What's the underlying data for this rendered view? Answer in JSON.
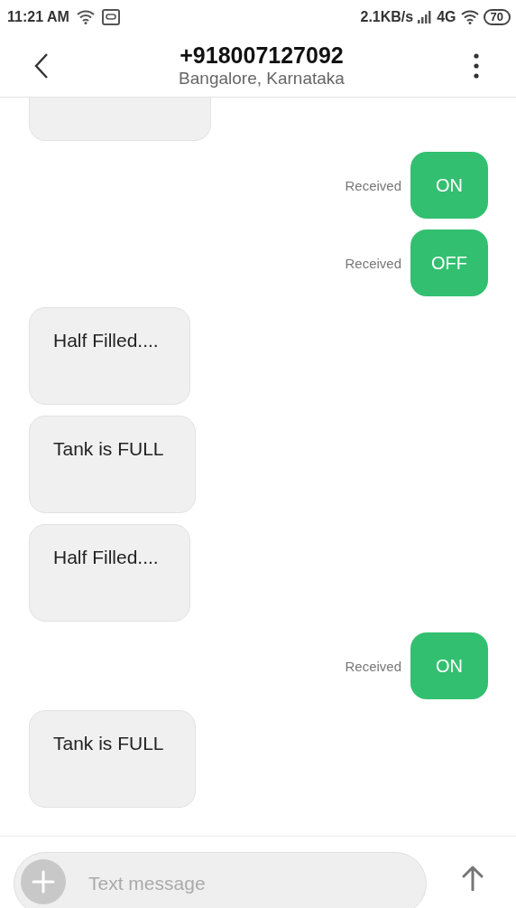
{
  "status_bar": {
    "time": "11:21 AM",
    "speed": "2.1KB/s",
    "network": "4G",
    "battery": "70"
  },
  "header": {
    "title": "+918007127092",
    "subtitle": "Bangalore, Karnataka"
  },
  "messages": [
    {
      "kind": "incoming",
      "cut": true
    },
    {
      "kind": "outgoing",
      "text": "ON",
      "status": "Received"
    },
    {
      "kind": "outgoing",
      "text": "OFF",
      "status": "Received"
    },
    {
      "kind": "incoming",
      "text": "Half Filled...."
    },
    {
      "kind": "incoming",
      "text": "Tank is FULL"
    },
    {
      "kind": "incoming",
      "text": "Half Filled...."
    },
    {
      "kind": "outgoing",
      "text": "ON",
      "status": "Received"
    },
    {
      "kind": "incoming",
      "text": "Tank is FULL"
    }
  ],
  "composer": {
    "placeholder": "Text message"
  }
}
